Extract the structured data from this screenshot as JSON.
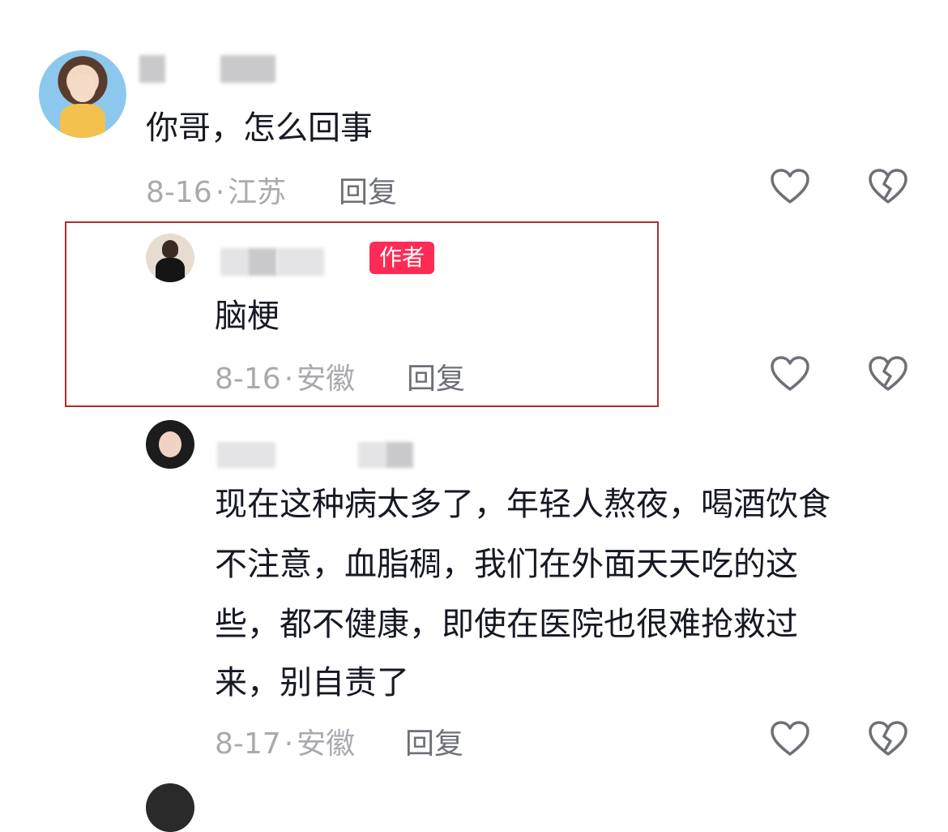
{
  "comments": [
    {
      "text": "你哥，怎么回事",
      "date": "8-16",
      "location": "江苏",
      "reply_label": "回复",
      "like_icon": "heart-outline-icon",
      "dislike_icon": "broken-heart-icon"
    },
    {
      "text": "脑梗",
      "badge": "作者",
      "date": "8-16",
      "location": "安徽",
      "reply_label": "回复",
      "like_icon": "heart-outline-icon",
      "dislike_icon": "broken-heart-icon",
      "highlighted": true
    },
    {
      "text_lines": [
        "现在这种病太多了，年轻人熬夜，喝酒饮食",
        "不注意，血脂稠，我们在外面天天吃的这",
        "些，都不健康，即使在医院也很难抢救过",
        "来，别自责了"
      ],
      "date": "8-17",
      "location": "安徽",
      "reply_label": "回复",
      "like_icon": "heart-outline-icon",
      "dislike_icon": "broken-heart-icon"
    }
  ],
  "colors": {
    "badge": "#fe2c55",
    "highlight_border": "#b42b2b",
    "meta_text": "#a9aab0",
    "reply_text": "#6e7078",
    "icon_stroke": "#6e7078"
  },
  "separator": "·"
}
